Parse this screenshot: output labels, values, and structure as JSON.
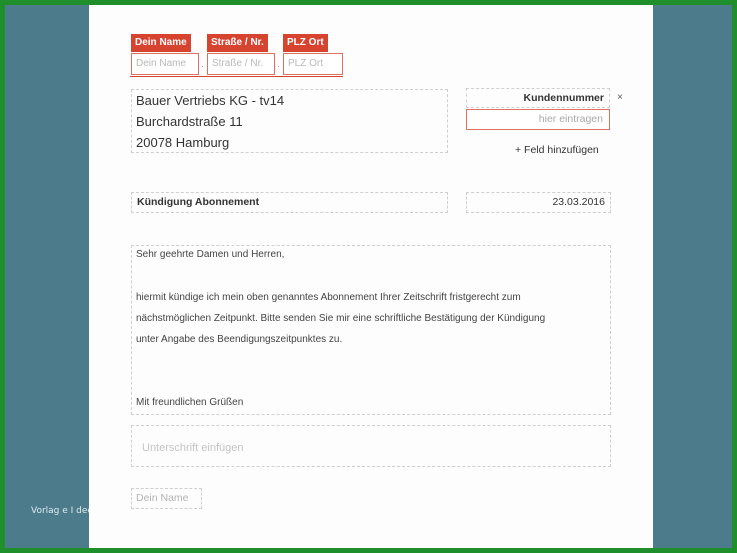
{
  "watermark": "Vorlag e I dee",
  "sender": {
    "name_tag": "Dein Name",
    "street_tag": "Straße / Nr.",
    "city_tag": "PLZ Ort",
    "name_placeholder": "Dein Name",
    "street_placeholder": "Straße / Nr.",
    "city_placeholder": "PLZ Ort",
    "separator": "·"
  },
  "recipient": {
    "line1": "Bauer Vertriebs KG - tv14",
    "line2": "Burchardstraße 11",
    "line3": "20078 Hamburg"
  },
  "customer_number": {
    "label": "Kundennummer",
    "close": "×",
    "placeholder": "hier eintragen",
    "add_field": "+ Feld hinzufügen"
  },
  "subject": "Kündigung Abonnement",
  "date": "23.03.2016",
  "letter": {
    "salutation": "Sehr geehrte Damen und Herren,",
    "line1": "hiermit kündige ich mein oben genanntes Abonnement Ihrer Zeitschrift fristgerecht zum",
    "line2": "nächstmöglichen Zeitpunkt. Bitte senden Sie mir eine schriftliche Bestätigung der Kündigung",
    "line3": "unter Angabe des Beendigungszeitpunktes zu.",
    "closing": "Mit freundlichen Grüßen"
  },
  "signature_placeholder": "Unterschrift einfügen",
  "name_placeholder_bottom": "Dein Name",
  "colors": {
    "accent": "#d6432f",
    "frame": "#1e8f2b",
    "background": "#4c7b8c"
  }
}
